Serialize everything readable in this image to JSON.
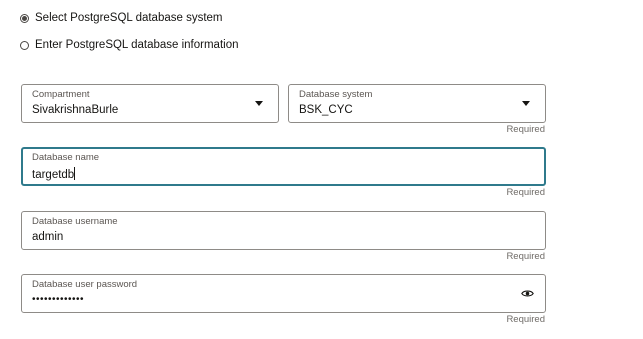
{
  "options": {
    "select_label": "Select PostgreSQL database system",
    "enter_label": "Enter PostgreSQL database information"
  },
  "compartment": {
    "label": "Compartment",
    "value": "SivakrishnaBurle"
  },
  "database_system": {
    "label": "Database system",
    "value": "BSK_CYC",
    "required": "Required"
  },
  "database_name": {
    "label": "Database name",
    "value": "targetdb",
    "required": "Required"
  },
  "database_username": {
    "label": "Database username",
    "value": "admin",
    "required": "Required"
  },
  "database_password": {
    "label": "Database user password",
    "value": "•••••••••••••",
    "required": "Required"
  },
  "colors": {
    "focus_border": "#2f7a8c",
    "border": "#8e8b87",
    "text": "#161513"
  }
}
